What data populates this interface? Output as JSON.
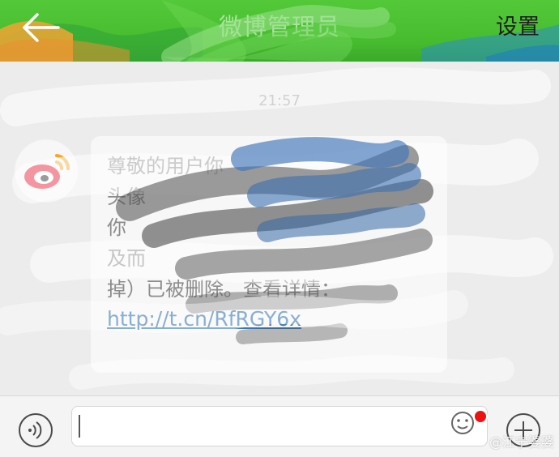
{
  "header": {
    "title": "微博管理员",
    "settings_label": "设置",
    "back_icon": "arrow-left-icon"
  },
  "chat": {
    "timestamp": "21:57",
    "sender_avatar": "weibo-logo",
    "message": {
      "lines": [
        "尊敬的用户你",
        "头像",
        "你",
        "",
        "及而",
        "掉）已被删除。查看详情："
      ],
      "link": "http://t.cn/RfRGY6x"
    }
  },
  "input_bar": {
    "voice_icon": "voice-icon",
    "text_value": "",
    "emoji_icon": "emoji-icon",
    "plus_icon": "plus-icon",
    "notification_dot_color": "#ee1111"
  },
  "watermark": "@江宁婆婆",
  "colors": {
    "header_green": "#46bb2e",
    "link_blue": "#3a78b5"
  }
}
